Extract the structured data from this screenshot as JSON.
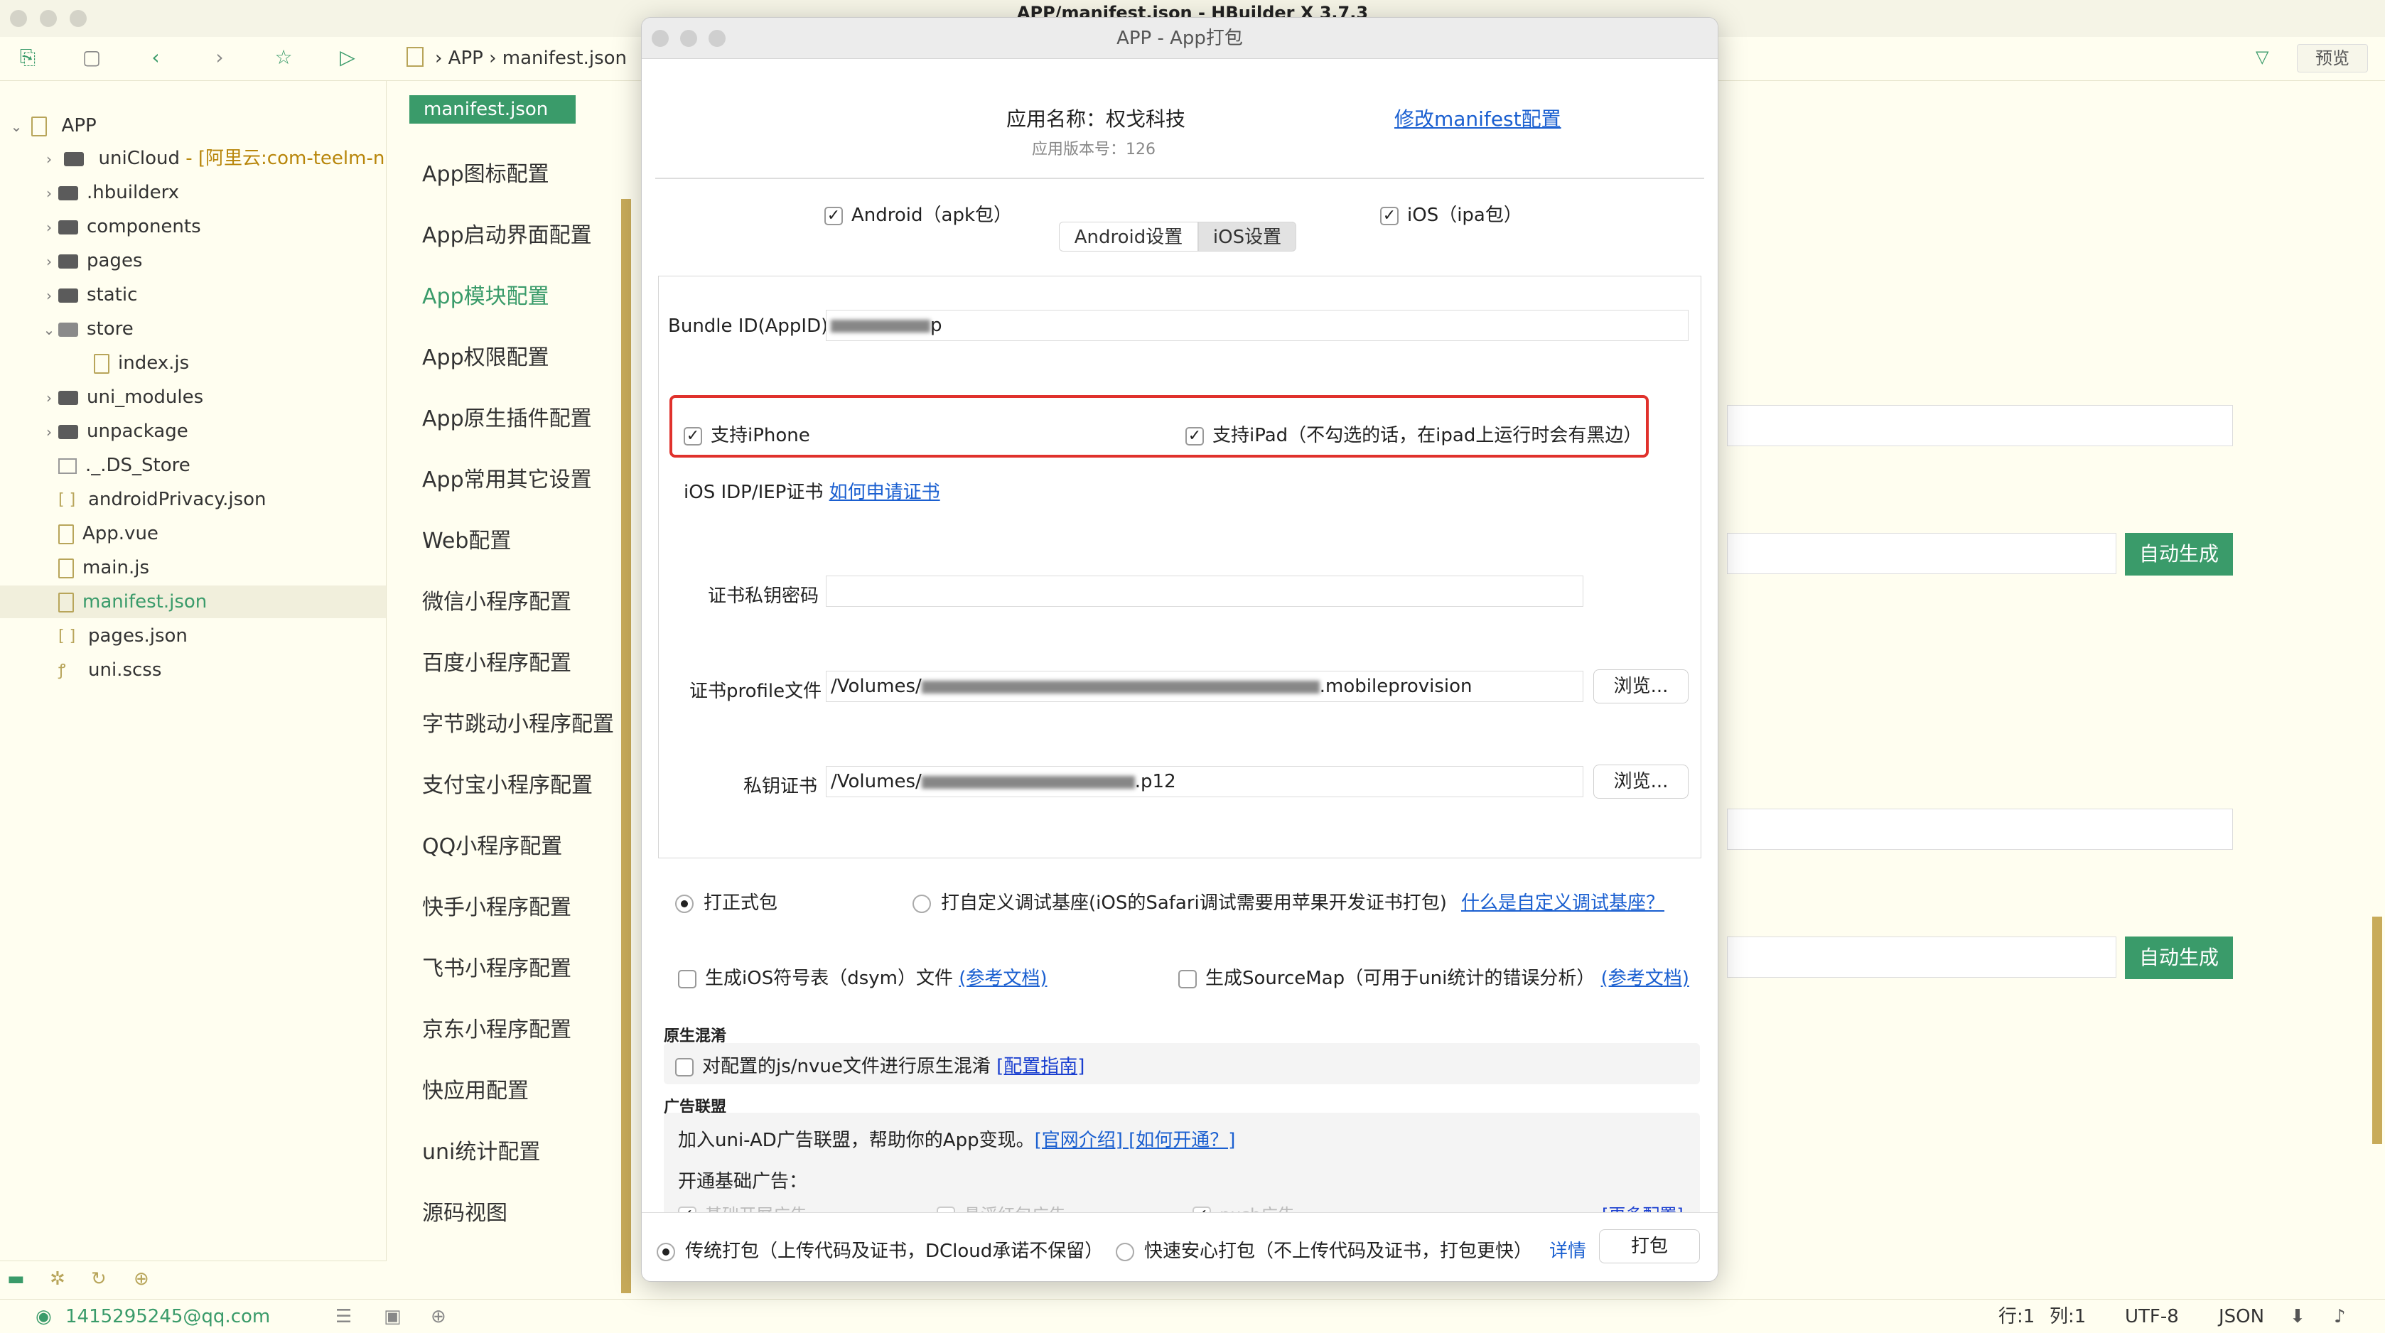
{
  "window": {
    "title": "APP/manifest.json - HBuilder X 3.7.3"
  },
  "toolbar": {
    "breadcrumb": [
      "APP",
      "manifest.json"
    ],
    "preview_label": "预览"
  },
  "tree": {
    "root": "APP",
    "items": [
      {
        "label": "uniCloud",
        "suffix": " - [阿里云:com-teelm-n"
      },
      {
        "label": ".hbuilderx"
      },
      {
        "label": "components"
      },
      {
        "label": "pages"
      },
      {
        "label": "static"
      },
      {
        "label": "store"
      },
      {
        "label": "index.js"
      },
      {
        "label": "uni_modules"
      },
      {
        "label": "unpackage"
      },
      {
        "label": "._.DS_Store"
      },
      {
        "label": "androidPrivacy.json"
      },
      {
        "label": "App.vue"
      },
      {
        "label": "main.js"
      },
      {
        "label": "manifest.json"
      },
      {
        "label": "pages.json"
      },
      {
        "label": "uni.scss"
      }
    ]
  },
  "config": {
    "tag": "manifest.json",
    "items": [
      "App图标配置",
      "App启动界面配置",
      "App模块配置",
      "App权限配置",
      "App原生插件配置",
      "App常用其它设置",
      "Web配置",
      "微信小程序配置",
      "百度小程序配置",
      "字节跳动小程序配置",
      "支付宝小程序配置",
      "QQ小程序配置",
      "快手小程序配置",
      "飞书小程序配置",
      "京东小程序配置",
      "快应用配置",
      "uni统计配置",
      "源码视图"
    ]
  },
  "right": {
    "auto_gen_1": "自动生成",
    "auto_gen_2": "自动生成"
  },
  "statusbar": {
    "account": "1415295245@qq.com",
    "line": "行:1",
    "col": "列:1",
    "encoding": "UTF-8",
    "lang": "JSON"
  },
  "modal": {
    "title": "APP - App打包",
    "app_name": "应用名称：权戈科技",
    "app_version": "应用版本号：126",
    "modify_link": "修改manifest配置",
    "android_check": "Android（apk包）",
    "ios_check": "iOS（ipa包）",
    "tab_android": "Android设置",
    "tab_ios": "iOS设置",
    "bundle_label": "Bundle ID(AppID)",
    "bundle_value_tail": "p",
    "support_iphone": "支持iPhone",
    "support_ipad": "支持iPad（不勾选的话，在ipad上运行时会有黑边）",
    "cert_label": "iOS IDP/IEP证书",
    "cert_link": "如何申请证书",
    "key_pwd_label": "证书私钥密码",
    "profile_label": "证书profile文件",
    "profile_value_head": "/Volumes/",
    "profile_value_tail": ".mobileprovision",
    "private_cert_label": "私钥证书",
    "private_value_head": "/Volumes/",
    "private_value_tail": ".p12",
    "browse": "浏览...",
    "release_pack": "打正式包",
    "custom_base": "打自定义调试基座(iOS的Safari调试需要用苹果开发证书打包)",
    "custom_base_link": "什么是自定义调试基座？",
    "dsym_check": "生成iOS符号表（dsym）文件",
    "dsym_link": "(参考文档)",
    "sourcemap_check": "生成SourceMap（可用于uni统计的错误分析）",
    "sourcemap_link": "(参考文档)",
    "obfuscation_title": "原生混淆",
    "obfuscation_check": "对配置的js/nvue文件进行原生混淆",
    "obfuscation_link": "[配置指南]",
    "ad_title": "广告联盟",
    "ad_desc": "加入uni-AD广告联盟，帮助你的App变现。",
    "ad_links": "[官网介绍] [如何开通？]",
    "ad_basic": "开通基础广告：",
    "ad_faded_1": "基础开屏广告",
    "ad_faded_2": "悬浮红包广告",
    "ad_faded_3": "push广告",
    "ad_more": "[更多配置]",
    "traditional": "传统打包（上传代码及证书，DCloud承诺不保留）",
    "fast": "快速安心打包（不上传代码及证书，打包更快）",
    "details": "详情",
    "pack": "打包"
  }
}
